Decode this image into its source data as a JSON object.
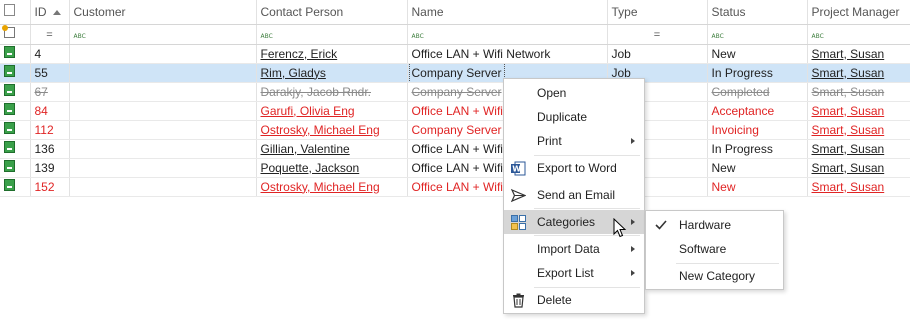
{
  "columns": [
    "",
    "ID",
    "Customer",
    "Contact Person",
    "Name",
    "Type",
    "Status",
    "Project Manager"
  ],
  "filter_row": {
    "id": "=",
    "type": "=",
    "abc": "ABC"
  },
  "rows": [
    {
      "id": "4",
      "customer": "",
      "contact": "Ferencz, Erick",
      "name": "Office LAN + Wifi Network",
      "type": "Job",
      "status": "New",
      "manager": "Smart, Susan",
      "style": "normal"
    },
    {
      "id": "55",
      "customer": "",
      "contact": "Rim, Gladys",
      "name": "Company Server",
      "type": "Job",
      "status": "In Progress",
      "manager": "Smart, Susan",
      "style": "selected"
    },
    {
      "id": "67",
      "customer": "",
      "contact": "Darakjy, Jacob Rndr.",
      "name": "Company Server",
      "type": "Job",
      "status": "Completed",
      "manager": "Smart, Susan",
      "style": "strike"
    },
    {
      "id": "84",
      "customer": "",
      "contact": "Garufi, Olivia Eng",
      "name": "Office LAN + Wifi N",
      "type": "",
      "status": "Acceptance",
      "manager": "Smart, Susan",
      "style": "red"
    },
    {
      "id": "112",
      "customer": "",
      "contact": "Ostrosky, Michael Eng",
      "name": "Company Server",
      "type": "",
      "status": "Invoicing",
      "manager": "Smart, Susan",
      "style": "red"
    },
    {
      "id": "136",
      "customer": "",
      "contact": "Gillian, Valentine",
      "name": "Office LAN + Wifi N",
      "type": "",
      "status": "In Progress",
      "manager": "Smart, Susan",
      "style": "normal"
    },
    {
      "id": "139",
      "customer": "",
      "contact": "Poquette, Jackson",
      "name": "Office LAN + Wifi N",
      "type": "",
      "status": "New",
      "manager": "Smart, Susan",
      "style": "normal"
    },
    {
      "id": "152",
      "customer": "",
      "contact": "Ostrosky, Michael Eng",
      "name": "Office LAN + Wifi N",
      "type": "",
      "status": "New",
      "manager": "Smart, Susan",
      "style": "red"
    }
  ],
  "context_menu": {
    "open": "Open",
    "duplicate": "Duplicate",
    "print": "Print",
    "export_word": "Export to Word",
    "send_email": "Send an Email",
    "categories": "Categories",
    "import_data": "Import Data",
    "export_list": "Export List",
    "delete": "Delete"
  },
  "submenu": {
    "hardware": "Hardware",
    "software": "Software",
    "new_category": "New Category"
  },
  "colors": {
    "selection": "#cfe4f7",
    "alert_red": "#e02424",
    "menu_hover": "#d6d6d6",
    "row_icon": "#3aa04a"
  },
  "icons": {
    "row": "green-record-icon",
    "new_row": "new-row-icon",
    "word": "word-icon",
    "email": "send-icon",
    "categories": "categories-icon",
    "delete": "trash-icon",
    "check": "check-icon"
  }
}
